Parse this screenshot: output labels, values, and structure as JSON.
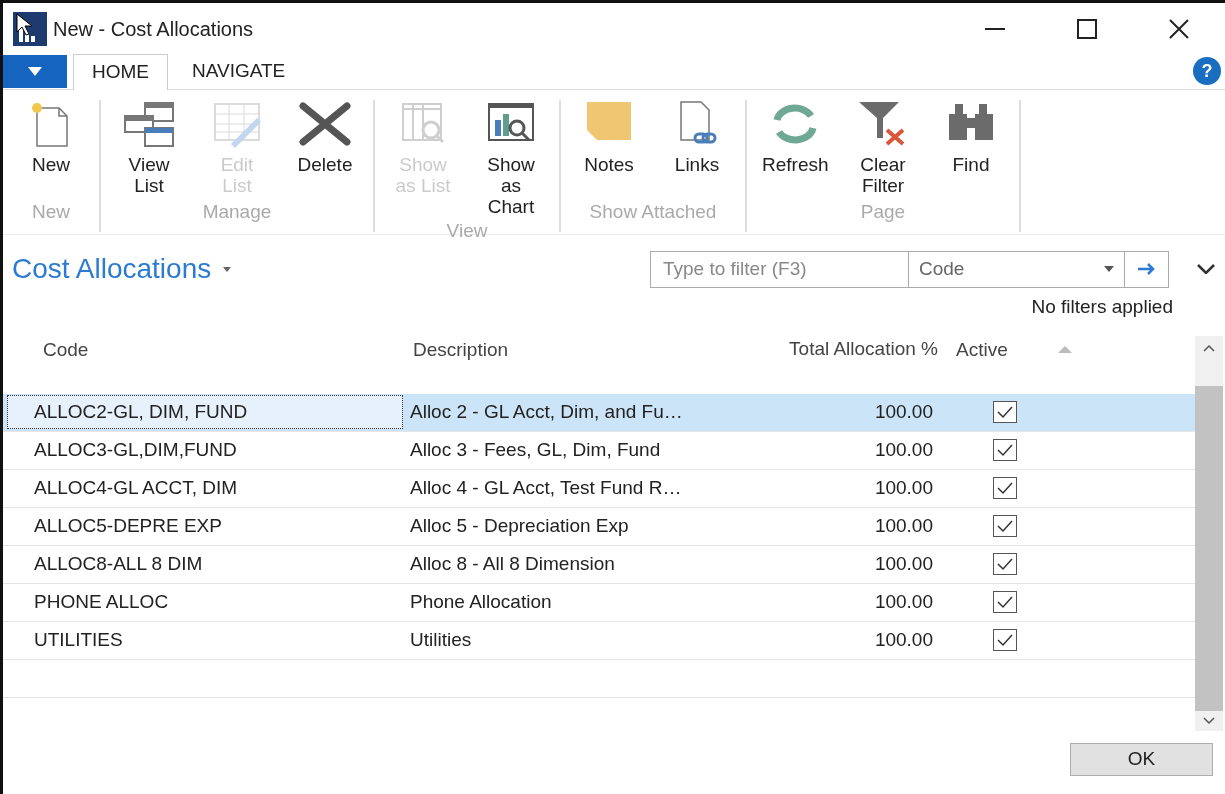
{
  "window": {
    "title": "New - Cost Allocations"
  },
  "help": "?",
  "tabs": [
    {
      "label": "HOME",
      "selected": true
    },
    {
      "label": "NAVIGATE",
      "selected": false
    }
  ],
  "ribbon_groups": [
    {
      "name": "New",
      "actions": [
        {
          "label": "New",
          "disabled": false
        }
      ]
    },
    {
      "name": "Manage",
      "actions": [
        {
          "label": "View List",
          "disabled": false
        },
        {
          "label": "Edit List",
          "disabled": true
        },
        {
          "label": "Delete",
          "disabled": false
        }
      ]
    },
    {
      "name": "View",
      "actions": [
        {
          "label": "Show as List",
          "disabled": true
        },
        {
          "label": "Show as Chart",
          "disabled": false
        }
      ]
    },
    {
      "name": "Show Attached",
      "actions": [
        {
          "label": "Notes",
          "disabled": false
        },
        {
          "label": "Links",
          "disabled": false
        }
      ]
    },
    {
      "name": "Page",
      "actions": [
        {
          "label": "Refresh",
          "disabled": false
        },
        {
          "label": "Clear Filter",
          "disabled": false
        },
        {
          "label": "Find",
          "disabled": false
        }
      ]
    }
  ],
  "page_title": "Cost Allocations",
  "filter": {
    "placeholder": "Type to filter (F3)",
    "field": "Code",
    "status": "No filters applied"
  },
  "table": {
    "columns": [
      "Code",
      "Description",
      "Total Allocation %",
      "Active"
    ],
    "rows": [
      {
        "code": "ALLOC2-GL, DIM, FUND",
        "description": "Alloc 2 - GL Acct, Dim, and Fu…",
        "total": "100.00",
        "active": true,
        "selected": true
      },
      {
        "code": "ALLOC3-GL,DIM,FUND",
        "description": "Alloc 3 - Fees, GL, Dim, Fund",
        "total": "100.00",
        "active": true,
        "selected": false
      },
      {
        "code": "ALLOC4-GL ACCT, DIM",
        "description": "Alloc 4 - GL Acct, Test Fund R…",
        "total": "100.00",
        "active": true,
        "selected": false
      },
      {
        "code": "ALLOC5-DEPRE EXP",
        "description": "Alloc 5 - Depreciation Exp",
        "total": "100.00",
        "active": true,
        "selected": false
      },
      {
        "code": "ALLOC8-ALL 8 DIM",
        "description": "Alloc 8 - All 8 Dimension",
        "total": "100.00",
        "active": true,
        "selected": false
      },
      {
        "code": "PHONE ALLOC",
        "description": "Phone Allocation",
        "total": "100.00",
        "active": true,
        "selected": false
      },
      {
        "code": "UTILITIES",
        "description": "Utilities",
        "total": "100.00",
        "active": true,
        "selected": false
      }
    ]
  },
  "buttons": [
    {
      "label": "OK"
    }
  ]
}
